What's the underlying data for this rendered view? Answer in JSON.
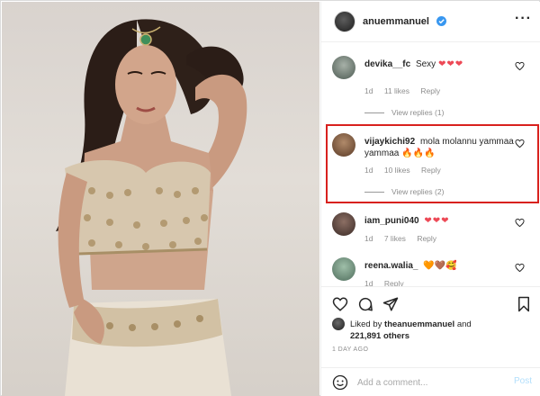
{
  "post": {
    "author": "anuemmanuel",
    "more_icon": "more-horizontal-icon"
  },
  "comments": [
    {
      "user": "devika__fc",
      "text": "Sexy",
      "emoji": "❤❤❤",
      "age": "1d",
      "likes": "11 likes",
      "reply": "Reply",
      "view_replies": "View replies (1)"
    },
    {
      "user": "vijaykichi92",
      "text": "mola molannu yammaa yammaa",
      "emoji": "🔥🔥🔥",
      "age": "1d",
      "likes": "10 likes",
      "reply": "Reply",
      "view_replies": "View replies (2)"
    },
    {
      "user": "iam_puni040",
      "text": "",
      "emoji": "❤❤❤",
      "age": "1d",
      "likes": "7 likes",
      "reply": "Reply"
    },
    {
      "user": "reena.walia_",
      "text": "",
      "emoji": "🧡🤎🥰",
      "age": "1d",
      "likes": "",
      "reply": "Reply"
    }
  ],
  "likes_summary": {
    "prefix": "Liked by",
    "user": "theanuemmanuel",
    "connector": "and",
    "count": "221,891 others"
  },
  "time_ago": "1 DAY AGO",
  "add_comment": {
    "placeholder": "Add a comment...",
    "post_label": "Post"
  },
  "colors": {
    "highlight": "#d8211e",
    "verified": "#3897f0",
    "heart": "#ed4956"
  }
}
